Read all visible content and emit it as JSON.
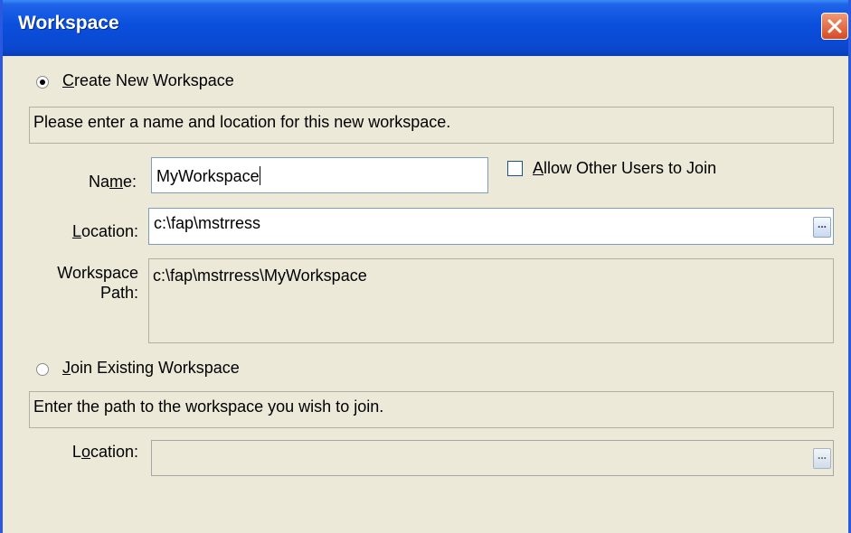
{
  "window": {
    "title": "Workspace",
    "close_symbol": "X"
  },
  "create": {
    "radio_label_prefix": "C",
    "radio_label_rest": "reate New Workspace",
    "selected": true,
    "hint": "Please enter a name and location for this new workspace.",
    "name_label_prefix": "Na",
    "name_label_hot": "m",
    "name_label_rest": "e:",
    "name_value": "MyWorkspace",
    "allow_label_prefix": "A",
    "allow_label_rest": "llow Other Users to Join",
    "allow_checked": false,
    "location_label_prefix": "L",
    "location_label_rest": "ocation:",
    "location_value": "c:\\fap\\mstrress",
    "path_label_line1": "Workspace",
    "path_label_line2": "Path:",
    "path_value": "c:\\fap\\mstrress\\MyWorkspace",
    "browse_label": "..."
  },
  "join": {
    "radio_label_prefix": "J",
    "radio_label_rest": "oin Existing Workspace",
    "selected": false,
    "hint": "Enter the path to the workspace you wish to join.",
    "location_label_prefix": "L",
    "location_label_hot": "o",
    "location_label_rest": "cation:",
    "location_value": "",
    "browse_label": "..."
  }
}
